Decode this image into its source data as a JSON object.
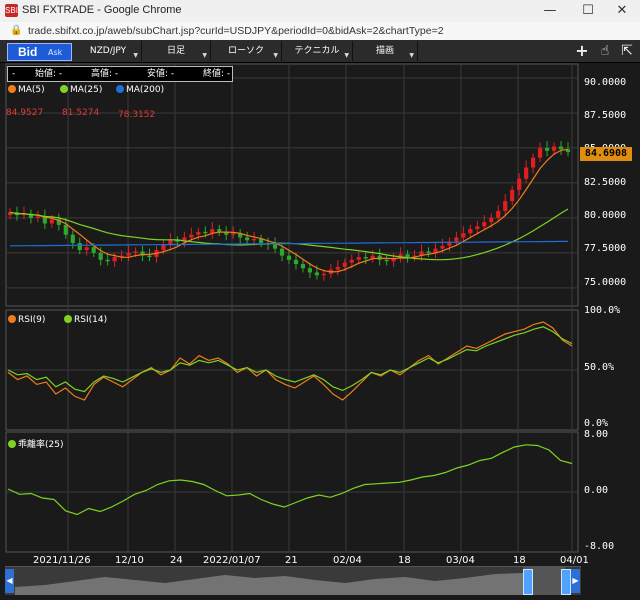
{
  "window": {
    "title": "SBI FXTRADE - Google Chrome",
    "url": "trade.sbifxt.co.jp/aweb/subChart.jsp?curId=USDJPY&periodId=0&bidAsk=2&chartType=2",
    "icon_text": "SBI",
    "minimize_glyph": "—",
    "maximize_glyph": "☐",
    "close_glyph": "✕"
  },
  "toolbar": {
    "bid_label": "Bid",
    "ask_label": "Ask",
    "pair_label": "NZD/JPY",
    "period_label": "日足",
    "chart_type_label": "ローソク",
    "technical_label": "テクニカル",
    "draw_label": "描画",
    "arrow_glyph": "▼",
    "crosshair_glyph": "+",
    "hand_glyph": "☝",
    "pointer_glyph": "⇱"
  },
  "ohlc": {
    "open": "始値: -",
    "high": "高値: -",
    "low": "安値: -",
    "close": "終値: -",
    "dash": "-"
  },
  "colors": {
    "ma5": "#f07d1a",
    "ma25": "#7ed321",
    "ma200": "#1e6fd9",
    "up_candle": "#e02020",
    "down_candle": "#2ea82e",
    "rsi9": "#f07d1a",
    "rsi14": "#7ed321",
    "deviation": "#7ed321",
    "grid": "#3a3a3a",
    "price_tag": "#e08e12"
  },
  "legends": {
    "ma5": "MA(5)",
    "ma25": "MA(25)",
    "ma200": "MA(200)",
    "ma5_value": "84.9527",
    "ma25_value": "81.5274",
    "ma200_value": "78.3152",
    "rsi9": "RSI(9)",
    "rsi14": "RSI(14)",
    "deviation": "乖離率(25)"
  },
  "current_price": "84.6908",
  "chart_data": [
    {
      "type": "candlestick",
      "panel": "price",
      "y_ticks": [
        "90.0000",
        "87.5000",
        "85.0000",
        "82.5000",
        "80.0000",
        "77.5000",
        "75.0000"
      ],
      "ylim": [
        73.7,
        91.0
      ],
      "x_ticks": [
        "2021/11/26",
        "12/10",
        "24",
        "2022/01/07",
        "21",
        "02/04",
        "18",
        "03/04",
        "18",
        "04/01"
      ],
      "close_series": [
        80.4,
        80.2,
        80.3,
        80.0,
        80.1,
        79.6,
        79.9,
        79.5,
        78.8,
        78.2,
        77.7,
        77.9,
        77.5,
        77.0,
        76.9,
        77.2,
        77.3,
        77.5,
        77.6,
        77.3,
        77.2,
        77.7,
        78.1,
        78.4,
        78.3,
        78.6,
        78.8,
        79.0,
        78.9,
        79.2,
        79.0,
        78.8,
        78.9,
        78.6,
        78.4,
        78.5,
        78.2,
        78.1,
        77.8,
        77.3,
        77.0,
        76.7,
        76.4,
        76.1,
        75.9,
        76.0,
        76.3,
        76.5,
        76.8,
        77.0,
        77.2,
        77.1,
        77.3,
        77.0,
        76.9,
        77.1,
        77.4,
        77.2,
        77.3,
        77.6,
        77.5,
        77.8,
        78.0,
        78.3,
        78.6,
        78.9,
        79.2,
        79.4,
        79.7,
        80.0,
        80.5,
        81.2,
        82.0,
        82.8,
        83.6,
        84.3,
        85.0,
        84.8,
        85.1,
        84.9,
        84.7
      ]
    },
    {
      "type": "line",
      "panel": "rsi",
      "y_ticks": [
        "100.0%",
        "50.0%",
        "0.0%"
      ],
      "ylim": [
        0,
        100
      ],
      "series": [
        {
          "name": "RSI(9)",
          "values": [
            48,
            42,
            45,
            38,
            40,
            30,
            35,
            28,
            25,
            38,
            44,
            40,
            36,
            42,
            48,
            52,
            46,
            50,
            60,
            55,
            62,
            58,
            60,
            55,
            48,
            52,
            45,
            50,
            42,
            38,
            35,
            40,
            45,
            38,
            30,
            25,
            32,
            40,
            48,
            45,
            50,
            46,
            52,
            58,
            62,
            55,
            60,
            65,
            70,
            68,
            72,
            76,
            80,
            82,
            84,
            88,
            90,
            85,
            75,
            70
          ]
        },
        {
          "name": "RSI(14)",
          "values": [
            50,
            46,
            47,
            42,
            44,
            36,
            40,
            34,
            32,
            40,
            45,
            43,
            40,
            44,
            48,
            51,
            48,
            50,
            56,
            54,
            58,
            56,
            58,
            54,
            50,
            52,
            48,
            50,
            45,
            42,
            40,
            43,
            46,
            42,
            36,
            33,
            37,
            42,
            48,
            46,
            50,
            48,
            52,
            56,
            60,
            56,
            59,
            63,
            67,
            66,
            70,
            73,
            76,
            79,
            81,
            84,
            86,
            82,
            76,
            72
          ]
        }
      ]
    },
    {
      "type": "line",
      "panel": "deviation",
      "y_ticks": [
        "8.00",
        "0.00",
        "-8.00"
      ],
      "ylim": [
        -8,
        8
      ],
      "series": [
        {
          "name": "乖離率(25)",
          "values": [
            0.4,
            -0.3,
            -0.2,
            -0.8,
            -1.0,
            -2.5,
            -3.0,
            -2.2,
            -2.6,
            -2.0,
            -1.2,
            -0.3,
            0.2,
            1.0,
            1.5,
            1.6,
            1.4,
            1.0,
            0.2,
            -0.5,
            -0.4,
            -0.2,
            -1.0,
            -1.6,
            -2.0,
            -1.4,
            -0.8,
            -0.4,
            -0.7,
            -0.2,
            0.5,
            1.0,
            1.1,
            1.2,
            1.3,
            1.6,
            2.0,
            2.2,
            2.6,
            3.2,
            3.6,
            4.2,
            4.5,
            5.3,
            6.0,
            6.3,
            6.2,
            5.6,
            4.2,
            3.8
          ]
        }
      ]
    }
  ]
}
